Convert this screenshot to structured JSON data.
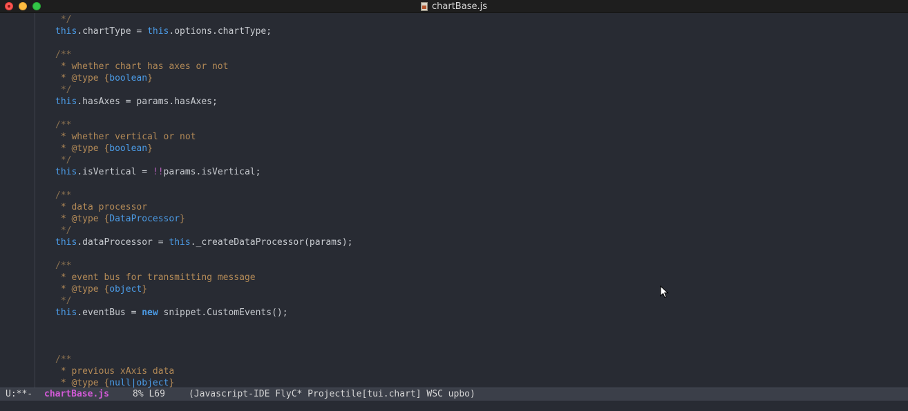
{
  "window": {
    "title": "chartBase.js"
  },
  "editor": {
    "lines": {
      "l1": " */",
      "l2a": "this",
      "l2b": ".chartType = ",
      "l2c": "this",
      "l2d": ".options.chartType;",
      "l3": "/**",
      "l4": " * whether chart has axes or not",
      "l5a": " * @type {",
      "l5b": "boolean",
      "l5c": "}",
      "l6": " */",
      "l7a": "this",
      "l7b": ".hasAxes = params.hasAxes;",
      "l8": "/**",
      "l9": " * whether vertical or not",
      "l10a": " * @type {",
      "l10b": "boolean",
      "l10c": "}",
      "l11": " */",
      "l12a": "this",
      "l12b": ".isVertical = ",
      "l12c": "!!",
      "l12d": "params.isVertical;",
      "l13": "/**",
      "l14": " * data processor",
      "l15a": " * @type {",
      "l15b": "DataProcessor",
      "l15c": "}",
      "l16": " */",
      "l17a": "this",
      "l17b": ".dataProcessor = ",
      "l17c": "this",
      "l17d": "._createDataProcessor(params);",
      "l18": "/**",
      "l19": " * event bus for transmitting message",
      "l20a": " * @type {",
      "l20b": "object",
      "l20c": "}",
      "l21": " */",
      "l22a": "this",
      "l22b": ".eventBus = ",
      "l22c": "new",
      "l22d": " snippet.CustomEvents();",
      "l23": "/**",
      "l24": " * previous xAxis data",
      "l25a": " * @type {",
      "l25b": "null|object",
      "l25c": "}"
    }
  },
  "modeline": {
    "status": "U:**-",
    "buffer": "chartBase.js",
    "position": "8% L69",
    "modes": "(Javascript-IDE FlyC* Projectile[tui.chart] WSC upbo)"
  },
  "colors": {
    "background": "#282b33",
    "keyword": "#4b9be6",
    "comment": "#b38a57",
    "buffer_name": "#d35ad8"
  }
}
